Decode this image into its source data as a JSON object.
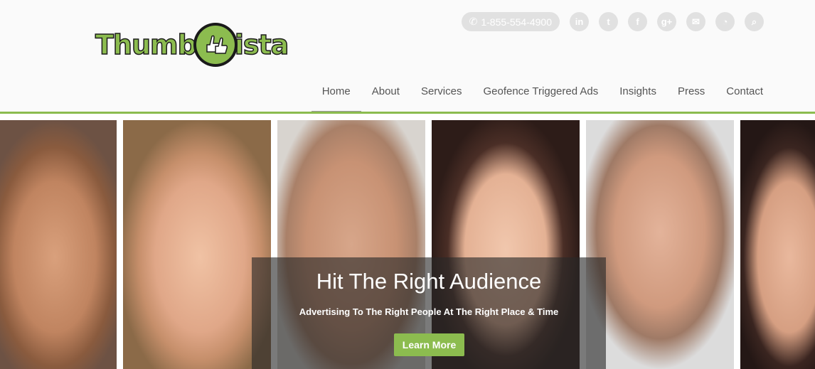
{
  "logo": {
    "text_left": "Thumb",
    "text_right": "ista"
  },
  "topbar": {
    "phone": "1-855-554-4900",
    "icons": [
      "linkedin-icon",
      "twitter-icon",
      "facebook-icon",
      "googleplus-icon",
      "email-icon",
      "rss-icon",
      "search-icon"
    ],
    "icon_glyphs": [
      "in",
      "t",
      "f",
      "g+",
      "✉",
      "◔",
      "⌕"
    ]
  },
  "nav": [
    "Home",
    "About",
    "Services",
    "Geofence Triggered Ads",
    "Insights",
    "Press",
    "Contact"
  ],
  "hero": {
    "title": "Hit The Right Audience",
    "subtitle": "Advertising To The Right People At The Right Place & Time",
    "button": "Learn More"
  },
  "colors": {
    "accent": "#8cbc4f",
    "icon_bg": "#e1e1e1",
    "nav_text": "#555555"
  }
}
